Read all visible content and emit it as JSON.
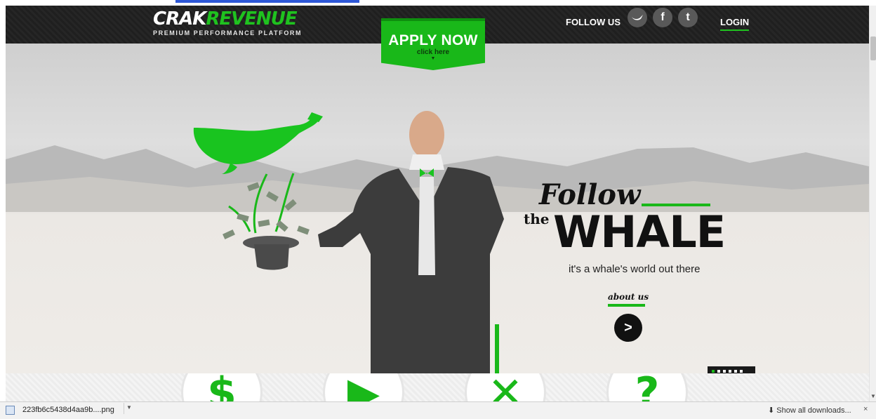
{
  "header": {
    "logo_part1": "CRAK",
    "logo_part2": "REVENUE",
    "tagline": "PREMIUM PERFORMANCE PLATFORM",
    "follow_label": "FOLLOW US",
    "social_icons": [
      "whale-icon",
      "facebook-icon",
      "tumblr-icon"
    ],
    "social_glyphs": [
      "",
      "f",
      "t"
    ],
    "login": "LOGIN"
  },
  "apply": {
    "title": "APPLY NOW",
    "subtitle": "click here",
    "arrow": "▼"
  },
  "hero": {
    "follow": "Follow",
    "the": "the",
    "whale": "WHALE",
    "tagline": "it's a whale's world out there",
    "about_label": "about us",
    "about_button": ">"
  },
  "slider": {
    "total": 6,
    "active_index": 0
  },
  "features": [
    {
      "icon": "dollar-icon",
      "glyph": "$"
    },
    {
      "icon": "play-icon",
      "glyph": "▶"
    },
    {
      "icon": "tools-icon",
      "glyph": "✕"
    },
    {
      "icon": "question-icon",
      "glyph": "?"
    }
  ],
  "download_bar": {
    "file_name": "223fb6c5438d4aa9b....png",
    "show_all": "Show all downloads...",
    "close": "×"
  },
  "colors": {
    "accent_green": "#19b819",
    "header_dark": "#1f1f1f"
  }
}
